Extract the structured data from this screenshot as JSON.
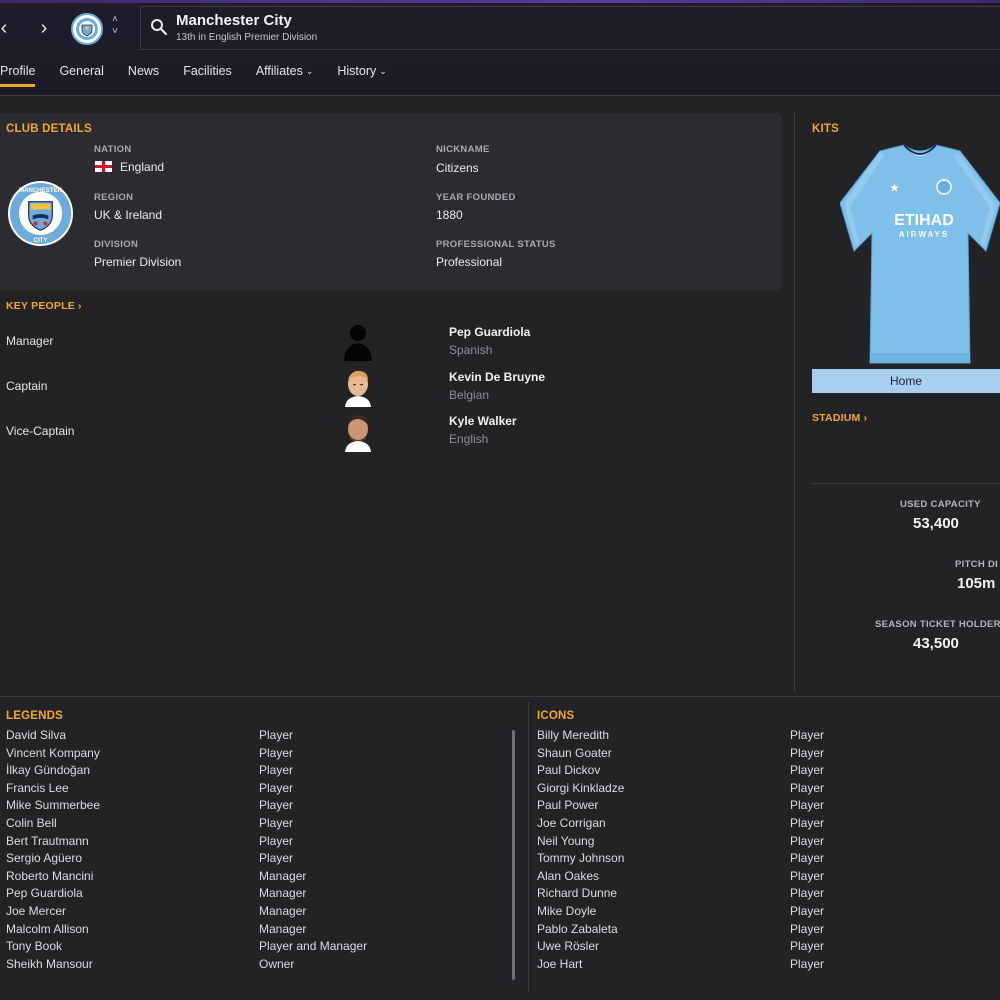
{
  "header": {
    "title": "Manchester City",
    "subtitle": "13th in English Premier Division"
  },
  "tabs": [
    {
      "label": "Profile",
      "active": true
    },
    {
      "label": "General"
    },
    {
      "label": "News"
    },
    {
      "label": "Facilities"
    },
    {
      "label": "Affiliates",
      "dropdown": true
    },
    {
      "label": "History",
      "dropdown": true
    }
  ],
  "club_details": {
    "title": "CLUB DETAILS",
    "nation_label": "NATION",
    "nation": "England",
    "region_label": "REGION",
    "region": "UK & Ireland",
    "division_label": "DIVISION",
    "division": "Premier Division",
    "nickname_label": "NICKNAME",
    "nickname": "Citizens",
    "founded_label": "YEAR FOUNDED",
    "founded": "1880",
    "status_label": "PROFESSIONAL STATUS",
    "status": "Professional",
    "badge_text_top": "MANCHESTER",
    "badge_text_bottom": "CITY"
  },
  "key_people": {
    "title": "KEY PEOPLE",
    "people": [
      {
        "role": "Manager",
        "name": "Pep Guardiola",
        "nationality": "Spanish"
      },
      {
        "role": "Captain",
        "name": "Kevin De Bruyne",
        "nationality": "Belgian"
      },
      {
        "role": "Vice-Captain",
        "name": "Kyle Walker",
        "nationality": "English"
      }
    ]
  },
  "kits": {
    "title": "KITS",
    "sponsor": "ETIHAD",
    "sponsor_sub": "AIRWAYS",
    "selected": "Home",
    "colors": {
      "shirt": "#7ec0ea",
      "collar": "#f2f4f8"
    }
  },
  "stadium": {
    "title": "STADIUM",
    "used_capacity_label": "USED CAPACITY",
    "used_capacity": "53,400",
    "pitch_label": "PITCH DI",
    "pitch": "105m",
    "season_ticket_label": "SEASON TICKET HOLDER",
    "season_ticket": "43,500"
  },
  "legends": {
    "title": "LEGENDS",
    "rows": [
      {
        "name": "David Silva",
        "role": "Player"
      },
      {
        "name": "Vincent Kompany",
        "role": "Player"
      },
      {
        "name": "İlkay Gündoğan",
        "role": "Player"
      },
      {
        "name": "Francis Lee",
        "role": "Player"
      },
      {
        "name": "Mike Summerbee",
        "role": "Player"
      },
      {
        "name": "Colin Bell",
        "role": "Player"
      },
      {
        "name": "Bert Trautmann",
        "role": "Player"
      },
      {
        "name": "Sergio Agüero",
        "role": "Player"
      },
      {
        "name": "Roberto Mancini",
        "role": "Manager"
      },
      {
        "name": "Pep Guardiola",
        "role": "Manager"
      },
      {
        "name": "Joe Mercer",
        "role": "Manager"
      },
      {
        "name": "Malcolm Allison",
        "role": "Manager"
      },
      {
        "name": "Tony Book",
        "role": "Player and Manager"
      },
      {
        "name": "Sheikh Mansour",
        "role": "Owner"
      }
    ]
  },
  "icons": {
    "title": "ICONS",
    "rows": [
      {
        "name": "Billy Meredith",
        "role": "Player"
      },
      {
        "name": "Shaun Goater",
        "role": "Player"
      },
      {
        "name": "Paul Dickov",
        "role": "Player"
      },
      {
        "name": "Giorgi Kinkladze",
        "role": "Player"
      },
      {
        "name": "Paul Power",
        "role": "Player"
      },
      {
        "name": "Joe Corrigan",
        "role": "Player"
      },
      {
        "name": "Neil Young",
        "role": "Player"
      },
      {
        "name": "Tommy Johnson",
        "role": "Player"
      },
      {
        "name": "Alan Oakes",
        "role": "Player"
      },
      {
        "name": "Richard Dunne",
        "role": "Player"
      },
      {
        "name": "Mike Doyle",
        "role": "Player"
      },
      {
        "name": "Pablo Zabaleta",
        "role": "Player"
      },
      {
        "name": "Uwe Rösler",
        "role": "Player"
      },
      {
        "name": "Joe Hart",
        "role": "Player"
      }
    ]
  }
}
